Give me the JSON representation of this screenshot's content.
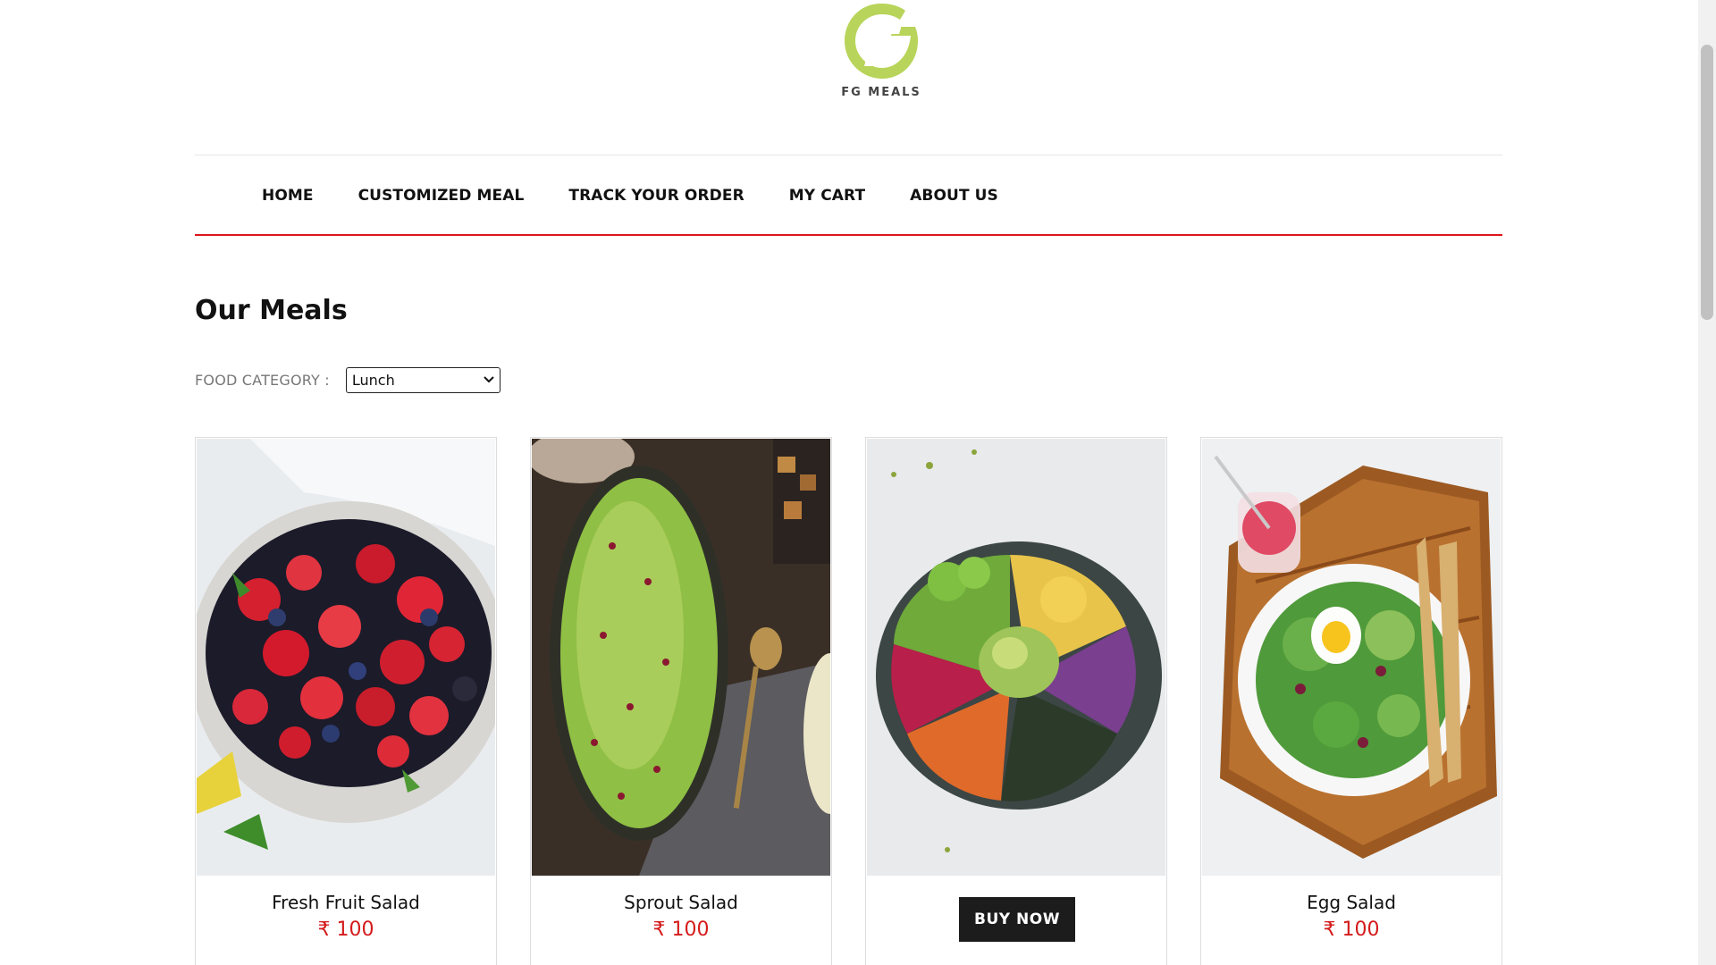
{
  "brand": {
    "name": "FG MEALS",
    "accent": "#b8d45a"
  },
  "nav": {
    "items": [
      {
        "label": "HOME"
      },
      {
        "label": "CUSTOMIZED MEAL"
      },
      {
        "label": "TRACK YOUR ORDER"
      },
      {
        "label": "MY CART"
      },
      {
        "label": "ABOUT US"
      }
    ],
    "underline_color": "#e0141b"
  },
  "page": {
    "title": "Our Meals"
  },
  "filter": {
    "label": "FOOD CATEGORY :",
    "selected": "Lunch"
  },
  "meals": [
    {
      "name": "Fresh Fruit Salad",
      "price": "₹ 100"
    },
    {
      "name": "Sprout Salad",
      "price": "₹ 100"
    },
    {
      "name": "",
      "price": "",
      "button": "BUY NOW"
    },
    {
      "name": "Egg Salad",
      "price": "₹ 100"
    }
  ],
  "colors": {
    "price": "#d41b1b",
    "button_bg": "#1c1c1c"
  }
}
